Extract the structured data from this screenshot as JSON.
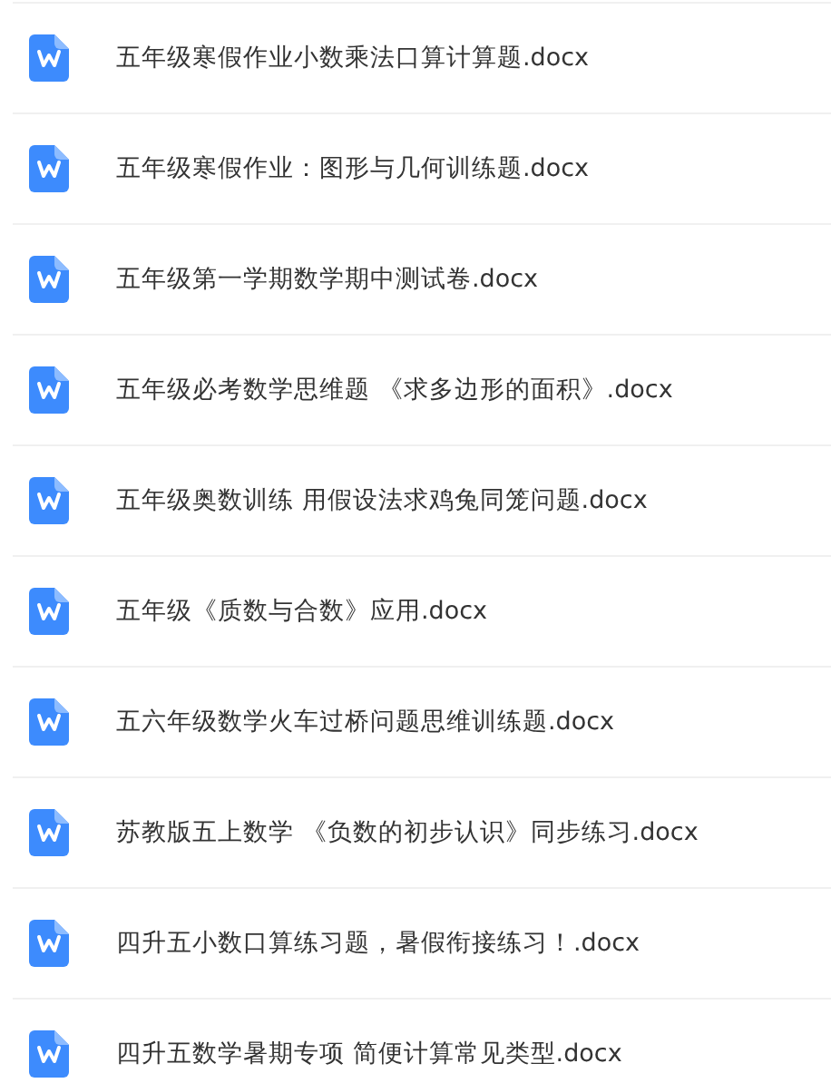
{
  "files": [
    {
      "name": "五年级寒假作业小数乘法口算计算题.docx",
      "kind": "word"
    },
    {
      "name": "五年级寒假作业：图形与几何训练题.docx",
      "kind": "word"
    },
    {
      "name": "五年级第一学期数学期中测试卷.docx",
      "kind": "word"
    },
    {
      "name": "五年级必考数学思维题 《求多边形的面积》.docx",
      "kind": "word"
    },
    {
      "name": "五年级奥数训练 用假设法求鸡兔同笼问题.docx",
      "kind": "word"
    },
    {
      "name": "五年级《质数与合数》应用.docx",
      "kind": "word"
    },
    {
      "name": "五六年级数学火车过桥问题思维训练题.docx",
      "kind": "word"
    },
    {
      "name": "苏教版五上数学 《负数的初步认识》同步练习.docx",
      "kind": "word"
    },
    {
      "name": "四升五小数口算练习题，暑假衔接练习！.docx",
      "kind": "word"
    },
    {
      "name": "四升五数学暑期专项 简便计算常见类型.docx",
      "kind": "word"
    }
  ]
}
